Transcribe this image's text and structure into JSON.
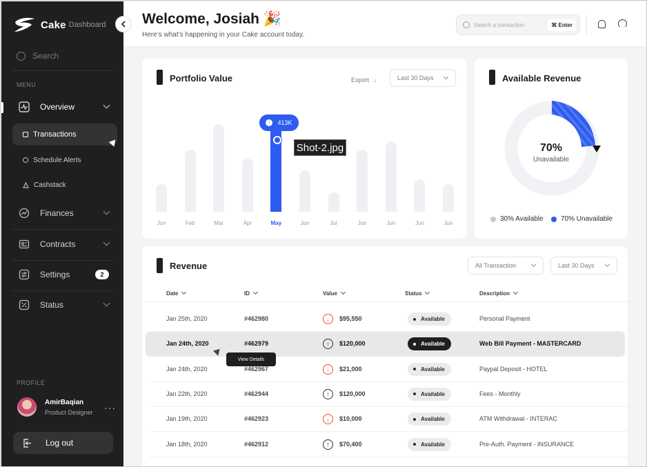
{
  "sidebar": {
    "logo": {
      "name": "Cake",
      "sub": "Dashboard"
    },
    "search_placeholder": "Search",
    "menu_label": "MENU",
    "items": [
      {
        "label": "Overview",
        "icon": "chart-line-icon"
      },
      {
        "label": "Finances",
        "icon": "trend-icon"
      },
      {
        "label": "Contracts",
        "icon": "contract-icon"
      },
      {
        "label": "Settings",
        "icon": "settings-sliders-icon",
        "badge": "2"
      },
      {
        "label": "Status",
        "icon": "percent-icon"
      }
    ],
    "sub_items": [
      {
        "label": "Transactions"
      },
      {
        "label": "Schedule Alerts"
      },
      {
        "label": "Cashstack"
      }
    ],
    "profile_label": "PROFILE",
    "profile": {
      "name": "AmirBaqian",
      "role": "Product Designer"
    },
    "logout_label": "Log out"
  },
  "header": {
    "title": "Welcome, Josiah 🎉",
    "subtitle": "Here’s what’s happening in your Cake account today.",
    "search_placeholder": "Search a transaction",
    "shortcut": "⌘ Enter"
  },
  "portfolio": {
    "title": "Portfolio Value",
    "export_label": "Export",
    "range": "Last 30 Days",
    "tooltip": "413K",
    "highlight_index": 4
  },
  "chart_data": {
    "type": "bar",
    "title": "Portfolio Value",
    "categories": [
      "Jun",
      "Feb",
      "Mar",
      "Apr",
      "May",
      "Jun",
      "Jul",
      "Jun",
      "Jun",
      "Jun",
      "Jun"
    ],
    "values": [
      120,
      270,
      380,
      230,
      413,
      180,
      85,
      270,
      305,
      140,
      120
    ],
    "ylim": [
      0,
      420
    ],
    "grid": false,
    "highlight": {
      "category": "May",
      "label": "413K"
    }
  },
  "overlay_label": "Shot-2.jpg",
  "revenue_card": {
    "title": "Available Revenue",
    "percent": "70%",
    "caption": "Unavailable",
    "legend": [
      {
        "label": "30% Available",
        "color": "#c5c7d0"
      },
      {
        "label": "70% Unavailable",
        "color": "#2e5bf0"
      }
    ]
  },
  "revenue_table": {
    "title": "Revenue",
    "filter1": "All Transaction",
    "filter2": "Last 30 Days",
    "columns": [
      "Date",
      "ID",
      "Value",
      "Status",
      "Description"
    ],
    "rows": [
      {
        "date": "Jan 25th, 2020",
        "id": "#462980",
        "value": "$95,550",
        "dir": "down",
        "status": "Available",
        "desc": "Personal Payment"
      },
      {
        "date": "Jan 24th, 2020",
        "id": "#462979",
        "value": "$120,000",
        "dir": "up",
        "status": "Available",
        "desc": "Web Bill Payment - MASTERCARD"
      },
      {
        "date": "Jan 24th, 2020",
        "id": "#462967",
        "value": "$21,000",
        "dir": "down",
        "status": "Available",
        "desc": "Paypal Deposit - HOTEL"
      },
      {
        "date": "Jan 22th, 2020",
        "id": "#462944",
        "value": "$120,000",
        "dir": "up",
        "status": "Available",
        "desc": "Fees - Monthly"
      },
      {
        "date": "Jan 19th, 2020",
        "id": "#462923",
        "value": "$10,000",
        "dir": "down",
        "status": "Available",
        "desc": "ATM Withdrawal - INTERAC"
      },
      {
        "date": "Jan 18th, 2020",
        "id": "#462912",
        "value": "$70,400",
        "dir": "up",
        "status": "Available",
        "desc": "Pre-Auth. Payment - INSURANCE"
      }
    ],
    "hover_tooltip": "View Details"
  }
}
